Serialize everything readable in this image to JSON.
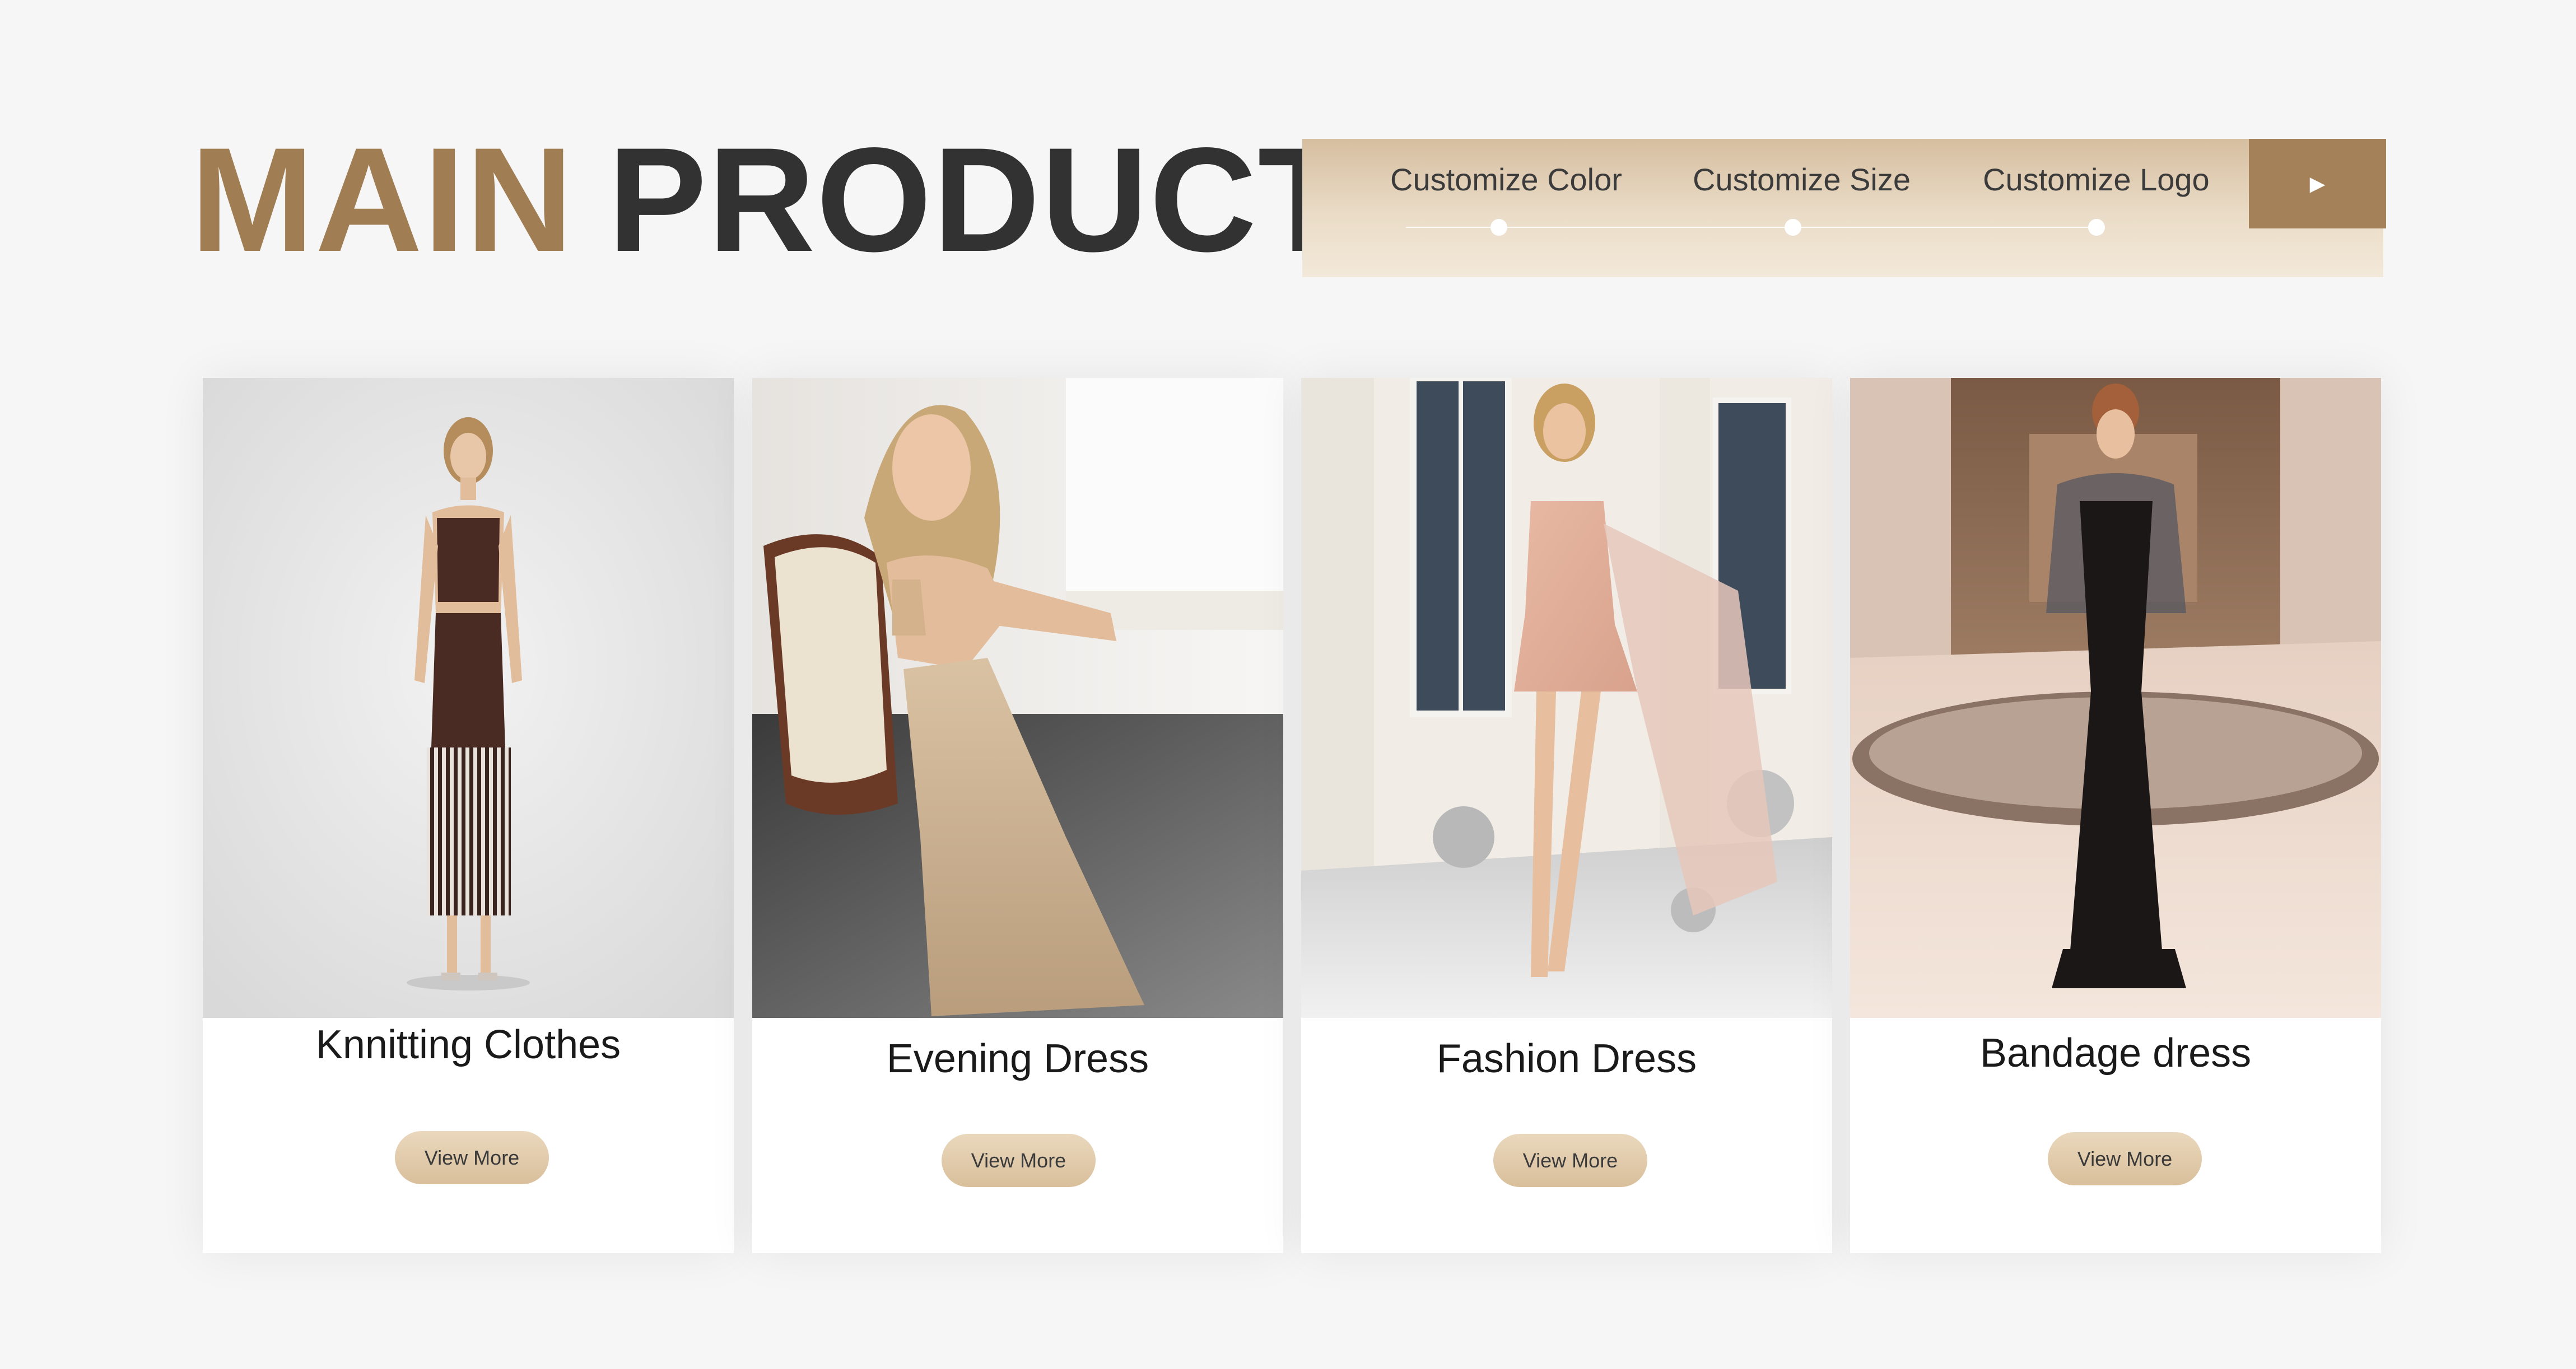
{
  "header": {
    "title_part1": "MAIN",
    "title_part2": "PRODUCT",
    "features": [
      "Customize Color",
      "Customize Size",
      "Customize Logo"
    ],
    "next_button": "►"
  },
  "colors": {
    "accent_gold": "#a07d52",
    "title_dark": "#323232",
    "button_beige": "#dcc3a1"
  },
  "products": [
    {
      "name": "Knnitting Clothes",
      "button": "View More"
    },
    {
      "name": "Evening Dress",
      "button": "View More"
    },
    {
      "name": "Fashion Dress",
      "button": "View More"
    },
    {
      "name": "Bandage dress",
      "button": "View More"
    }
  ]
}
